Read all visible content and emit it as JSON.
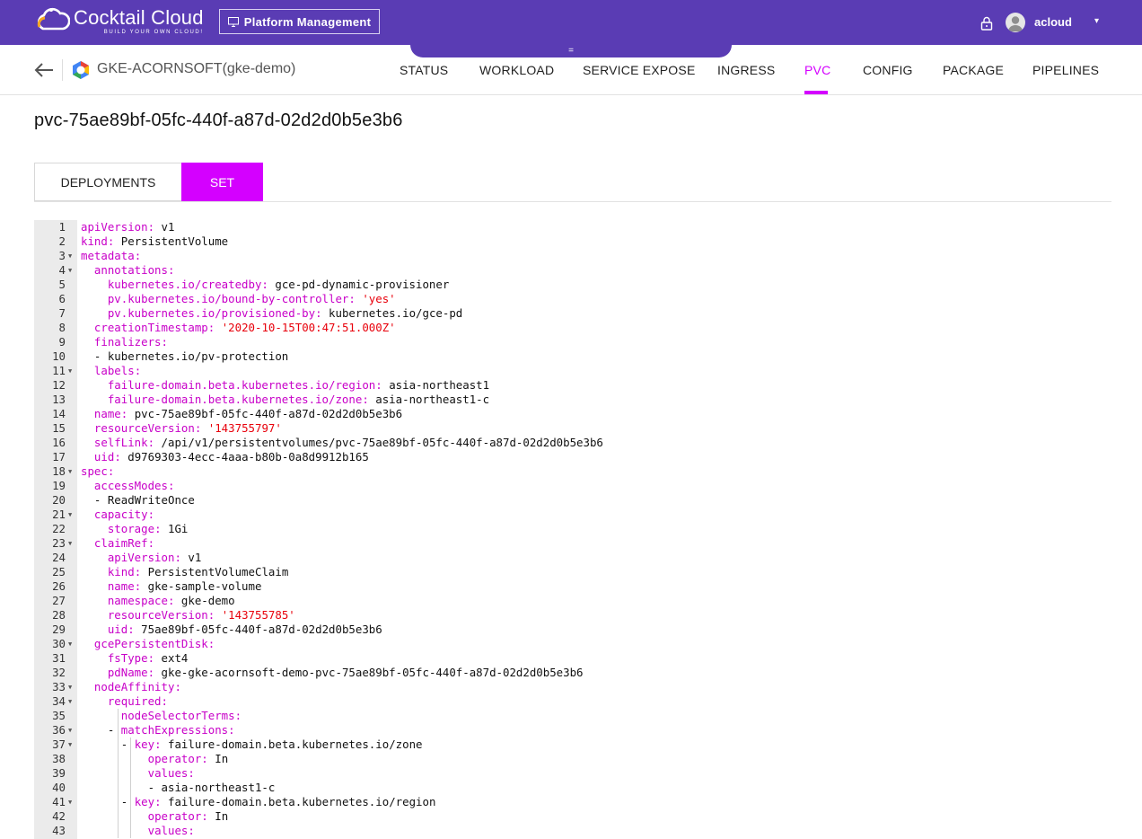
{
  "app": {
    "logo_name": "Cocktail Cloud",
    "logo_tagline": "BUILD YOUR OWN CLOUD!",
    "platform_button": "Platform Management",
    "drawer_handle": "=",
    "username": "acloud",
    "caret": "▾"
  },
  "header": {
    "cluster_name": "GKE-ACORNSOFT(gke-demo)",
    "nav": [
      "STATUS",
      "WORKLOAD",
      "SERVICE EXPOSE",
      "INGRESS",
      "PVC",
      "CONFIG",
      "PACKAGE",
      "PIPELINES"
    ],
    "active_nav": "PVC",
    "accent": "#d400ff"
  },
  "page": {
    "title": "pvc-75ae89bf-05fc-440f-a87d-02d2d0b5e3b6"
  },
  "tabs": {
    "deployments": "DEPLOYMENTS",
    "set": "SET",
    "active": "SET"
  },
  "editor": {
    "lines": [
      {
        "n": "1",
        "key": "apiVersion",
        "val": "v1",
        "ind": 0
      },
      {
        "n": "2",
        "key": "kind",
        "val": "PersistentVolume",
        "ind": 0
      },
      {
        "n": "3",
        "key": "metadata",
        "val": "",
        "ind": 0,
        "fold": true
      },
      {
        "n": "4",
        "key": "annotations",
        "val": "",
        "ind": 1,
        "fold": true
      },
      {
        "n": "5",
        "key": "kubernetes.io/createdby",
        "val": "gce-pd-dynamic-provisioner",
        "ind": 2
      },
      {
        "n": "6",
        "key": "pv.kubernetes.io/bound-by-controller",
        "val": "'yes'",
        "ind": 2,
        "str": true
      },
      {
        "n": "7",
        "key": "pv.kubernetes.io/provisioned-by",
        "val": "kubernetes.io/gce-pd",
        "ind": 2
      },
      {
        "n": "8",
        "key": "creationTimestamp",
        "val": "'2020-10-15T00:47:51.000Z'",
        "ind": 1,
        "str": true
      },
      {
        "n": "9",
        "key": "finalizers",
        "val": "",
        "ind": 1
      },
      {
        "n": "10",
        "dash": "kubernetes.io/pv-protection",
        "ind": 1
      },
      {
        "n": "11",
        "key": "labels",
        "val": "",
        "ind": 1,
        "fold": true
      },
      {
        "n": "12",
        "key": "failure-domain.beta.kubernetes.io/region",
        "val": "asia-northeast1",
        "ind": 2
      },
      {
        "n": "13",
        "key": "failure-domain.beta.kubernetes.io/zone",
        "val": "asia-northeast1-c",
        "ind": 2
      },
      {
        "n": "14",
        "key": "name",
        "val": "pvc-75ae89bf-05fc-440f-a87d-02d2d0b5e3b6",
        "ind": 1
      },
      {
        "n": "15",
        "key": "resourceVersion",
        "val": "'143755797'",
        "ind": 1,
        "str": true
      },
      {
        "n": "16",
        "key": "selfLink",
        "val": "/api/v1/persistentvolumes/pvc-75ae89bf-05fc-440f-a87d-02d2d0b5e3b6",
        "ind": 1
      },
      {
        "n": "17",
        "key": "uid",
        "val": "d9769303-4ecc-4aaa-b80b-0a8d9912b165",
        "ind": 1
      },
      {
        "n": "18",
        "key": "spec",
        "val": "",
        "ind": 0,
        "fold": true
      },
      {
        "n": "19",
        "key": "accessModes",
        "val": "",
        "ind": 1
      },
      {
        "n": "20",
        "dash": "ReadWriteOnce",
        "ind": 1
      },
      {
        "n": "21",
        "key": "capacity",
        "val": "",
        "ind": 1,
        "fold": true
      },
      {
        "n": "22",
        "key": "storage",
        "val": "1Gi",
        "ind": 2
      },
      {
        "n": "23",
        "key": "claimRef",
        "val": "",
        "ind": 1,
        "fold": true
      },
      {
        "n": "24",
        "key": "apiVersion",
        "val": "v1",
        "ind": 2
      },
      {
        "n": "25",
        "key": "kind",
        "val": "PersistentVolumeClaim",
        "ind": 2
      },
      {
        "n": "26",
        "key": "name",
        "val": "gke-sample-volume",
        "ind": 2
      },
      {
        "n": "27",
        "key": "namespace",
        "val": "gke-demo",
        "ind": 2
      },
      {
        "n": "28",
        "key": "resourceVersion",
        "val": "'143755785'",
        "ind": 2,
        "str": true
      },
      {
        "n": "29",
        "key": "uid",
        "val": "75ae89bf-05fc-440f-a87d-02d2d0b5e3b6",
        "ind": 2
      },
      {
        "n": "30",
        "key": "gcePersistentDisk",
        "val": "",
        "ind": 1,
        "fold": true
      },
      {
        "n": "31",
        "key": "fsType",
        "val": "ext4",
        "ind": 2
      },
      {
        "n": "32",
        "key": "pdName",
        "val": "gke-gke-acornsoft-demo-pvc-75ae89bf-05fc-440f-a87d-02d2d0b5e3b6",
        "ind": 2
      },
      {
        "n": "33",
        "key": "nodeAffinity",
        "val": "",
        "ind": 1,
        "fold": true
      },
      {
        "n": "34",
        "key": "required",
        "val": "",
        "ind": 2,
        "fold": true
      },
      {
        "n": "35",
        "key": "nodeSelectorTerms",
        "val": "",
        "ind": 3
      },
      {
        "n": "36",
        "key": "matchExpressions",
        "val": "",
        "ind": 3,
        "dashkey": true,
        "fold": true
      },
      {
        "n": "37",
        "key": "key",
        "val": "failure-domain.beta.kubernetes.io/zone",
        "ind": 4,
        "dashkey": true,
        "fold": true
      },
      {
        "n": "38",
        "key": "operator",
        "val": "In",
        "ind": 5
      },
      {
        "n": "39",
        "key": "values",
        "val": "",
        "ind": 5
      },
      {
        "n": "40",
        "dash": "asia-northeast1-c",
        "ind": 5
      },
      {
        "n": "41",
        "key": "key",
        "val": "failure-domain.beta.kubernetes.io/region",
        "ind": 4,
        "dashkey": true,
        "fold": true
      },
      {
        "n": "42",
        "key": "operator",
        "val": "In",
        "ind": 5
      },
      {
        "n": "43",
        "key": "values",
        "val": "",
        "ind": 5
      }
    ]
  }
}
